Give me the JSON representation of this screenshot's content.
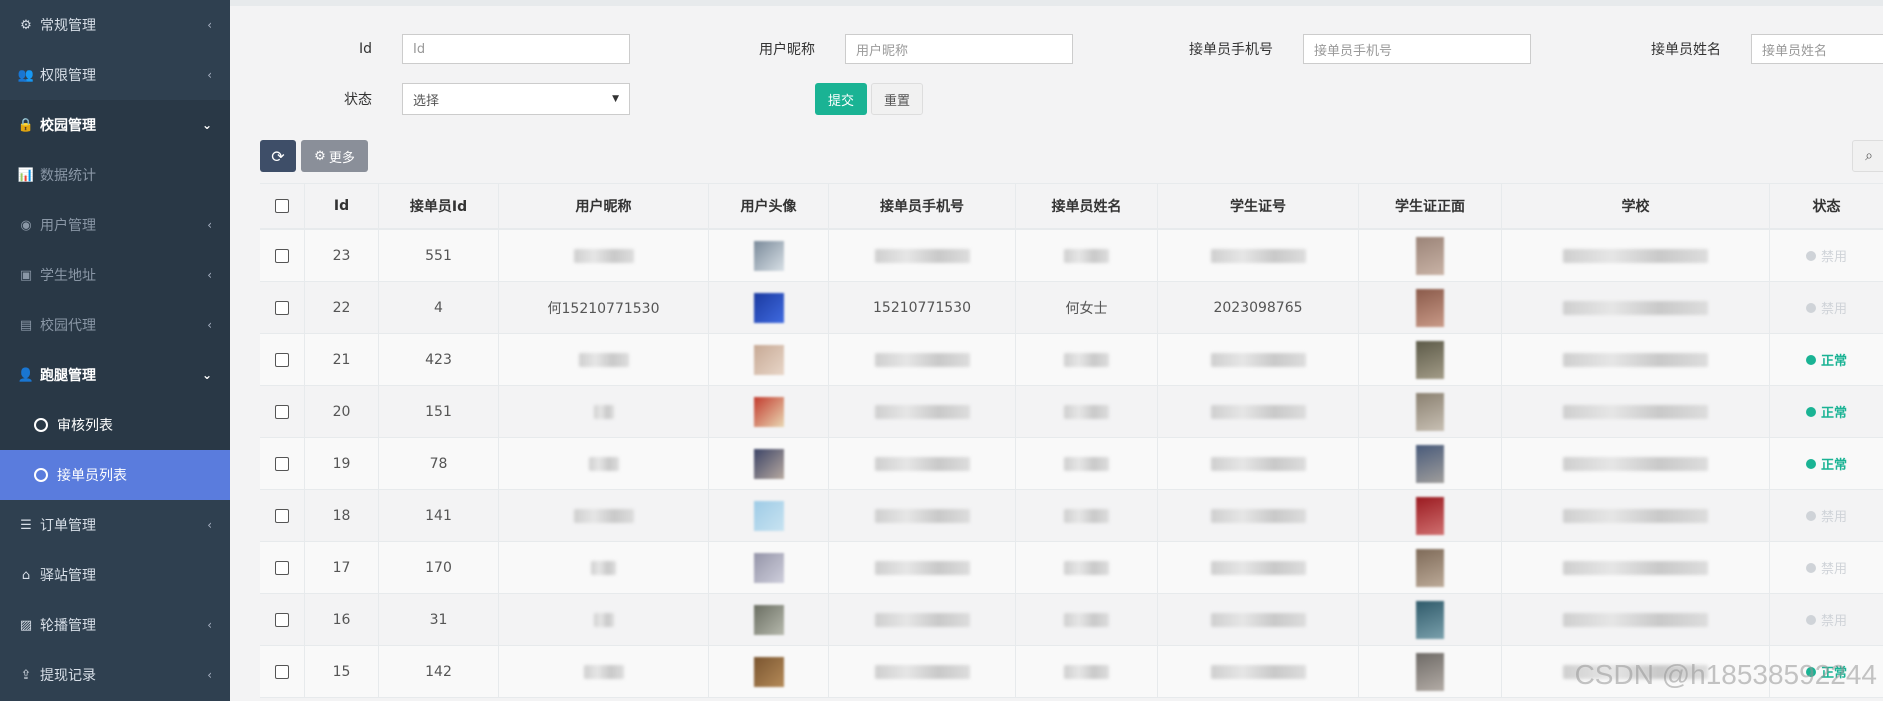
{
  "sidebar": {
    "items": [
      {
        "label": "常规管理",
        "icon": "gears-icon"
      },
      {
        "label": "权限管理",
        "icon": "users-icon"
      },
      {
        "label": "校园管理",
        "icon": "lock-icon"
      },
      {
        "label": "数据统计",
        "icon": "bar-chart-icon"
      },
      {
        "label": "用户管理",
        "icon": "user-circle-icon"
      },
      {
        "label": "学生地址",
        "icon": "id-card-icon"
      },
      {
        "label": "校园代理",
        "icon": "portrait-icon"
      },
      {
        "label": "跑腿管理",
        "icon": "user-icon"
      },
      {
        "label": "审核列表",
        "icon": "circle-icon"
      },
      {
        "label": "接单员列表",
        "icon": "circle-icon"
      },
      {
        "label": "订单管理",
        "icon": "list-icon"
      },
      {
        "label": "驿站管理",
        "icon": "home-icon"
      },
      {
        "label": "轮播管理",
        "icon": "image-icon"
      },
      {
        "label": "提现记录",
        "icon": "upload-icon"
      }
    ]
  },
  "filters": {
    "id_label": "Id",
    "id_placeholder": "Id",
    "nick_label": "用户昵称",
    "nick_placeholder": "用户昵称",
    "phone_label": "接单员手机号",
    "phone_placeholder": "接单员手机号",
    "name_label": "接单员姓名",
    "name_placeholder": "接单员姓名",
    "status_label": "状态",
    "status_value": "选择",
    "submit_label": "提交",
    "reset_label": "重置"
  },
  "toolbar": {
    "more_label": "更多"
  },
  "table": {
    "headers": [
      "Id",
      "接单员Id",
      "用户昵称",
      "用户头像",
      "接单员手机号",
      "接单员姓名",
      "学生证号",
      "学生证正面",
      "学校",
      "状态"
    ],
    "rows": [
      {
        "id": "23",
        "rid": "551",
        "nick": "",
        "phone": "",
        "name": "",
        "sid": "",
        "status": "禁用"
      },
      {
        "id": "22",
        "rid": "4",
        "nick": "何15210771530",
        "phone": "15210771530",
        "name": "何女士",
        "sid": "2023098765",
        "status": "禁用"
      },
      {
        "id": "21",
        "rid": "423",
        "nick": "",
        "phone": "",
        "name": "",
        "sid": "",
        "status": "正常"
      },
      {
        "id": "20",
        "rid": "151",
        "nick": "",
        "phone": "",
        "name": "",
        "sid": "",
        "status": "正常"
      },
      {
        "id": "19",
        "rid": "78",
        "nick": "",
        "phone": "",
        "name": "",
        "sid": "",
        "status": "正常"
      },
      {
        "id": "18",
        "rid": "141",
        "nick": "",
        "phone": "",
        "name": "",
        "sid": "",
        "status": "禁用"
      },
      {
        "id": "17",
        "rid": "170",
        "nick": "",
        "phone": "",
        "name": "",
        "sid": "",
        "status": "禁用"
      },
      {
        "id": "16",
        "rid": "31",
        "nick": "",
        "phone": "",
        "name": "",
        "sid": "",
        "status": "禁用"
      },
      {
        "id": "15",
        "rid": "142",
        "nick": "",
        "phone": "",
        "name": "",
        "sid": "",
        "status": "正常"
      }
    ]
  },
  "colors": {
    "sidebar": "#2f4050",
    "active": "#5a7cdd",
    "green": "#1ab394",
    "disabled": "#cfd3d8"
  },
  "watermark": "CSDN @h18538592244"
}
